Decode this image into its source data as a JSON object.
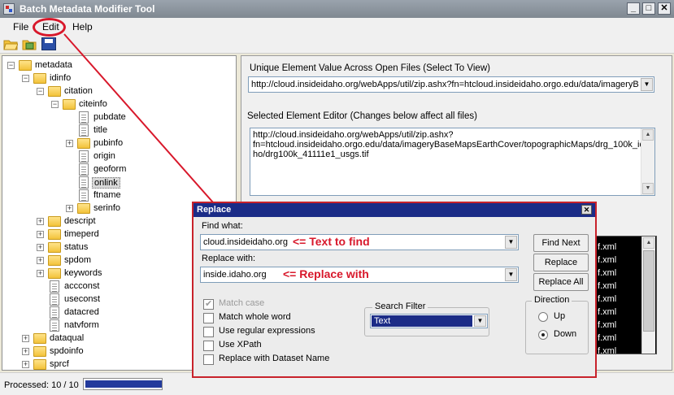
{
  "window": {
    "title": "Batch Metadata Modifier Tool",
    "min": "_",
    "max": "□",
    "close": "✕"
  },
  "menu": {
    "file": "File",
    "edit": "Edit",
    "help": "Help"
  },
  "tree": [
    {
      "label": "metadata",
      "type": "folder",
      "expander": "−"
    },
    {
      "label": "idinfo",
      "type": "folder",
      "expander": "−"
    },
    {
      "label": "citation",
      "type": "folder",
      "expander": "−"
    },
    {
      "label": "citeinfo",
      "type": "folder",
      "expander": "−"
    },
    {
      "label": "pubdate",
      "type": "doc"
    },
    {
      "label": "title",
      "type": "doc"
    },
    {
      "label": "pubinfo",
      "type": "folder",
      "expander": "+"
    },
    {
      "label": "origin",
      "type": "doc"
    },
    {
      "label": "geoform",
      "type": "doc"
    },
    {
      "label": "onlink",
      "type": "doc",
      "selected": true
    },
    {
      "label": "ftname",
      "type": "doc"
    },
    {
      "label": "serinfo",
      "type": "folder",
      "expander": "+"
    },
    {
      "label": "descript",
      "type": "folder",
      "expander": "+"
    },
    {
      "label": "timeperd",
      "type": "folder",
      "expander": "+"
    },
    {
      "label": "status",
      "type": "folder",
      "expander": "+"
    },
    {
      "label": "spdom",
      "type": "folder",
      "expander": "+"
    },
    {
      "label": "keywords",
      "type": "folder",
      "expander": "+"
    },
    {
      "label": "accconst",
      "type": "doc"
    },
    {
      "label": "useconst",
      "type": "doc"
    },
    {
      "label": "datacred",
      "type": "doc"
    },
    {
      "label": "natvform",
      "type": "doc"
    },
    {
      "label": "dataqual",
      "type": "folder",
      "expander": "+"
    },
    {
      "label": "spdoinfo",
      "type": "folder",
      "expander": "+"
    },
    {
      "label": "sprcf",
      "type": "folder",
      "expander": "+"
    }
  ],
  "right": {
    "unique_label": "Unique Element Value Across Open Files (Select To View)",
    "unique_value": "http://cloud.insideidaho.org/webApps/util/zip.ashx?fn=htcloud.insideidaho.orgo.edu/data/imageryBaseMapsEarthCover",
    "editor_label": "Selected Element Editor (Changes below affect all files)",
    "editor_line1": "http://cloud.insideidaho.org/webApps/util/zip.ashx?",
    "editor_line2": "fn=htcloud.insideidaho.orgo.edu/data/imageryBaseMapsEarthCover/topographicMaps/drg_100k_ida",
    "editor_line3": "ho/drg100k_41111e1_usgs.tif",
    "results": [
      "f.xml",
      "f.xml",
      "f.xml",
      "f.xml",
      "f.xml",
      "f.xml",
      "f.xml",
      "f.xml",
      "f.xml"
    ]
  },
  "status": {
    "processed": "Processed: 10 / 10",
    "progress_fraction": 1.0
  },
  "dialog": {
    "title": "Replace",
    "close": "✕",
    "find_label": "Find what:",
    "find_value": "cloud.insideidaho.org",
    "find_note": "<= Text to find",
    "replace_label": "Replace with:",
    "replace_value": "inside.idaho.org",
    "replace_note": "<= Replace with",
    "find_next": "Find Next",
    "replace": "Replace",
    "replace_all": "Replace All",
    "options": [
      {
        "label": "Match case",
        "checked": true,
        "disabled": true
      },
      {
        "label": "Match whole word",
        "checked": false
      },
      {
        "label": "Use regular expressions",
        "checked": false
      },
      {
        "label": "Use XPath",
        "checked": false
      },
      {
        "label": "Replace with Dataset Name",
        "checked": false
      }
    ],
    "filter_title": "Search Filter",
    "filter_value": "Text",
    "direction_title": "Direction",
    "dir_up": "Up",
    "dir_down": "Down",
    "direction_selected": "Down"
  },
  "colors": {
    "annotation": "#d8182b",
    "dialog_title": "#1b2c87",
    "progress": "#233a9c"
  }
}
